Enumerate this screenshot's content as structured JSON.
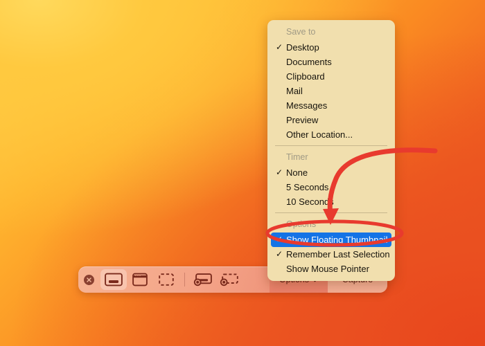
{
  "desktop": {
    "background_top_left_color": "#ffd24a",
    "background_bottom_right_color": "#e8481d"
  },
  "menu": {
    "accent_highlight_color": "#1473e6",
    "panel_color": "#f1dfae",
    "sections": [
      {
        "header": "Save to",
        "items": [
          {
            "label": "Desktop",
            "checked": "✓"
          },
          {
            "label": "Documents",
            "checked": ""
          },
          {
            "label": "Clipboard",
            "checked": ""
          },
          {
            "label": "Mail",
            "checked": ""
          },
          {
            "label": "Messages",
            "checked": ""
          },
          {
            "label": "Preview",
            "checked": ""
          },
          {
            "label": "Other Location...",
            "checked": ""
          }
        ]
      },
      {
        "header": "Timer",
        "items": [
          {
            "label": "None",
            "checked": "✓"
          },
          {
            "label": "5 Seconds",
            "checked": ""
          },
          {
            "label": "10 Seconds",
            "checked": ""
          }
        ]
      },
      {
        "header": "Options",
        "items": [
          {
            "label": "Show Floating Thumbnail",
            "checked": "✓",
            "highlighted": true
          },
          {
            "label": "Remember Last Selection",
            "checked": "✓"
          },
          {
            "label": "Show Mouse Pointer",
            "checked": ""
          }
        ]
      }
    ]
  },
  "toolbar": {
    "close_label": "Close",
    "tools": [
      {
        "name": "capture-entire-screen",
        "selected": true
      },
      {
        "name": "capture-selected-window",
        "selected": false
      },
      {
        "name": "capture-selected-portion",
        "selected": false
      },
      {
        "name": "record-entire-screen",
        "selected": false
      },
      {
        "name": "record-selected-portion",
        "selected": false
      }
    ],
    "options_label": "Options",
    "capture_label": "Capture"
  },
  "annotation": {
    "color": "#e83030",
    "arrow_name": "red-curved-arrow",
    "ellipse_name": "red-highlight-ellipse"
  }
}
